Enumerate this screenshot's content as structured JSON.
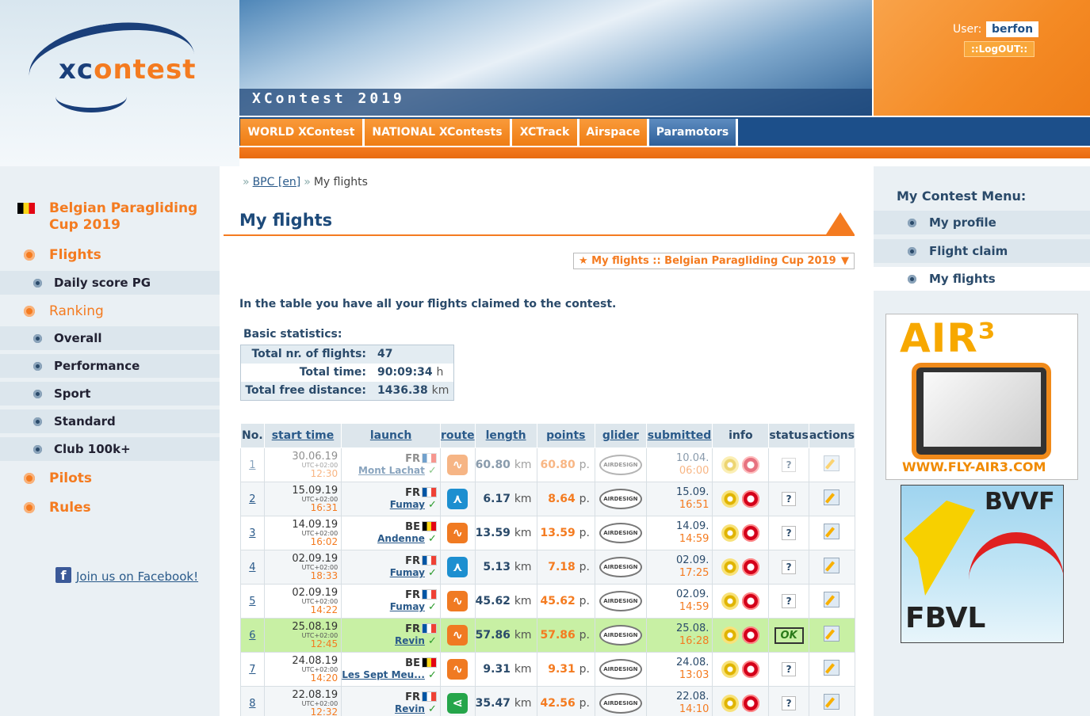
{
  "header": {
    "logo": {
      "x": "xc",
      "c": "ontest"
    },
    "banner_title": "XContest 2019",
    "user_label": "User:",
    "user_name": "berfon",
    "logout": "::LogOUT::",
    "nav": [
      "WORLD XContest",
      "NATIONAL XContests",
      "XCTrack",
      "Airspace",
      "Paramotors"
    ]
  },
  "left": {
    "contest": "Belgian Paragliding Cup 2019",
    "flights": "Flights",
    "daily": "Daily score PG",
    "ranking": "Ranking",
    "rank_items": [
      "Overall",
      "Performance",
      "Sport",
      "Standard",
      "Club 100k+"
    ],
    "pilots": "Pilots",
    "rules": "Rules",
    "facebook": "Join us on Facebook!"
  },
  "main": {
    "breadcrumb": {
      "link": "BPC [en]",
      "current": "My flights"
    },
    "title": "My flights",
    "selector": "★ My flights :: Belgian Paragliding Cup 2019",
    "intro": "In the table you have all your flights claimed to the contest.",
    "stats_label": "Basic statistics:",
    "stats": [
      {
        "k": "Total nr. of flights:",
        "v": "47",
        "u": ""
      },
      {
        "k": "Total time:",
        "v": "90:09:34",
        "u": "h"
      },
      {
        "k": "Total free distance:",
        "v": "1436.38",
        "u": "km"
      }
    ],
    "columns": [
      "No.",
      "start time",
      "launch",
      "route",
      "length",
      "points",
      "glider",
      "submitted",
      "info",
      "status",
      "actions"
    ],
    "utc": "UTC+02:00",
    "rows": [
      {
        "no": "1",
        "date": "30.06.19",
        "time": "12:30",
        "cc": "FR",
        "flag": "fr",
        "site": "Mont Lachat",
        "route": "orange",
        "len": "60.80",
        "pts": "60.80",
        "sub_d": "10.04.",
        "sub_h": "06:00",
        "status": "?"
      },
      {
        "no": "2",
        "date": "15.09.19",
        "time": "16:31",
        "cc": "FR",
        "flag": "fr",
        "site": "Fumay",
        "route": "blue",
        "len": "6.17",
        "pts": "8.64",
        "sub_d": "15.09.",
        "sub_h": "16:51",
        "status": "?"
      },
      {
        "no": "3",
        "date": "14.09.19",
        "time": "16:02",
        "cc": "BE",
        "flag": "be",
        "site": "Andenne",
        "route": "orange",
        "len": "13.59",
        "pts": "13.59",
        "sub_d": "14.09.",
        "sub_h": "14:59",
        "status": "?"
      },
      {
        "no": "4",
        "date": "02.09.19",
        "time": "18:33",
        "cc": "FR",
        "flag": "fr",
        "site": "Fumay",
        "route": "blue",
        "len": "5.13",
        "pts": "7.18",
        "sub_d": "02.09.",
        "sub_h": "17:25",
        "status": "?"
      },
      {
        "no": "5",
        "date": "02.09.19",
        "time": "14:22",
        "cc": "FR",
        "flag": "fr",
        "site": "Fumay",
        "route": "orange",
        "len": "45.62",
        "pts": "45.62",
        "sub_d": "02.09.",
        "sub_h": "14:59",
        "status": "?"
      },
      {
        "no": "6",
        "date": "25.08.19",
        "time": "12:45",
        "cc": "FR",
        "flag": "fr",
        "site": "Revin",
        "route": "orange",
        "len": "57.86",
        "pts": "57.86",
        "sub_d": "25.08.",
        "sub_h": "16:28",
        "status": "OK"
      },
      {
        "no": "7",
        "date": "24.08.19",
        "time": "14:20",
        "cc": "BE",
        "flag": "be",
        "site": "Les Sept Meu...",
        "route": "orange",
        "len": "9.31",
        "pts": "9.31",
        "sub_d": "24.08.",
        "sub_h": "13:03",
        "status": "?"
      },
      {
        "no": "8",
        "date": "22.08.19",
        "time": "12:32",
        "cc": "FR",
        "flag": "fr",
        "site": "Revin",
        "route": "green",
        "len": "35.47",
        "pts": "42.56",
        "sub_d": "22.08.",
        "sub_h": "14:10",
        "status": "?"
      }
    ],
    "unit_km": "km",
    "unit_p": "p.",
    "glider_text": "AIRDESIGN"
  },
  "right": {
    "menu_title": "My Contest Menu:",
    "items": [
      "My profile",
      "Flight claim",
      "My flights"
    ],
    "ad1": {
      "title": "AIR³",
      "url": "WWW.FLY-AIR3.COM"
    },
    "ad2": {
      "t1": "BVVF",
      "t2": "FBVL"
    }
  }
}
